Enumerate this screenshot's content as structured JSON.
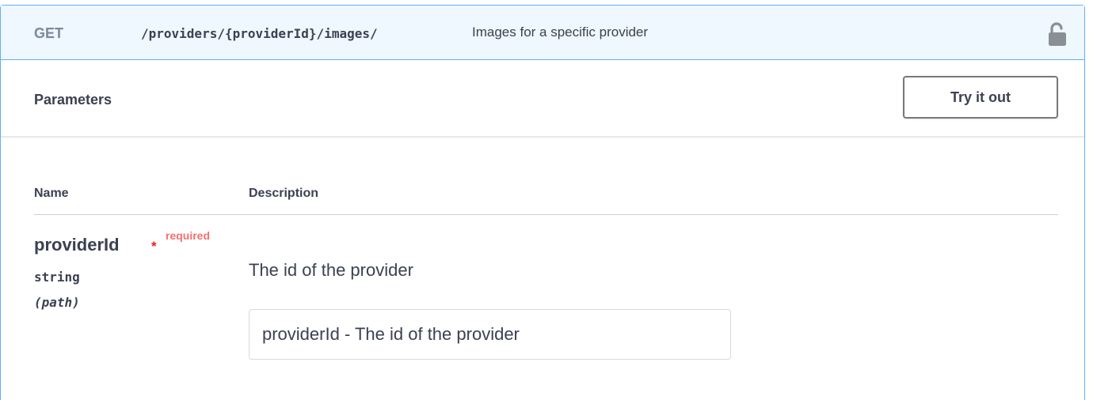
{
  "operation": {
    "method": "GET",
    "path": "/providers/{providerId}/images/",
    "summary": "Images for a specific provider",
    "lock_icon": "unlocked-padlock-icon"
  },
  "parameters_section": {
    "title": "Parameters",
    "try_button_label": "Try it out"
  },
  "table": {
    "headers": {
      "name": "Name",
      "description": "Description"
    },
    "rows": [
      {
        "name": "providerId",
        "required_star": "*",
        "required_label": "required",
        "type": "string",
        "in": "(path)",
        "description": "The id of the provider",
        "input_placeholder": "providerId - The id of the provider"
      }
    ]
  },
  "colors": {
    "accent": "#61affe",
    "summary_bg": "#eff7ff",
    "text": "#3b4151",
    "required": "#f57070"
  }
}
